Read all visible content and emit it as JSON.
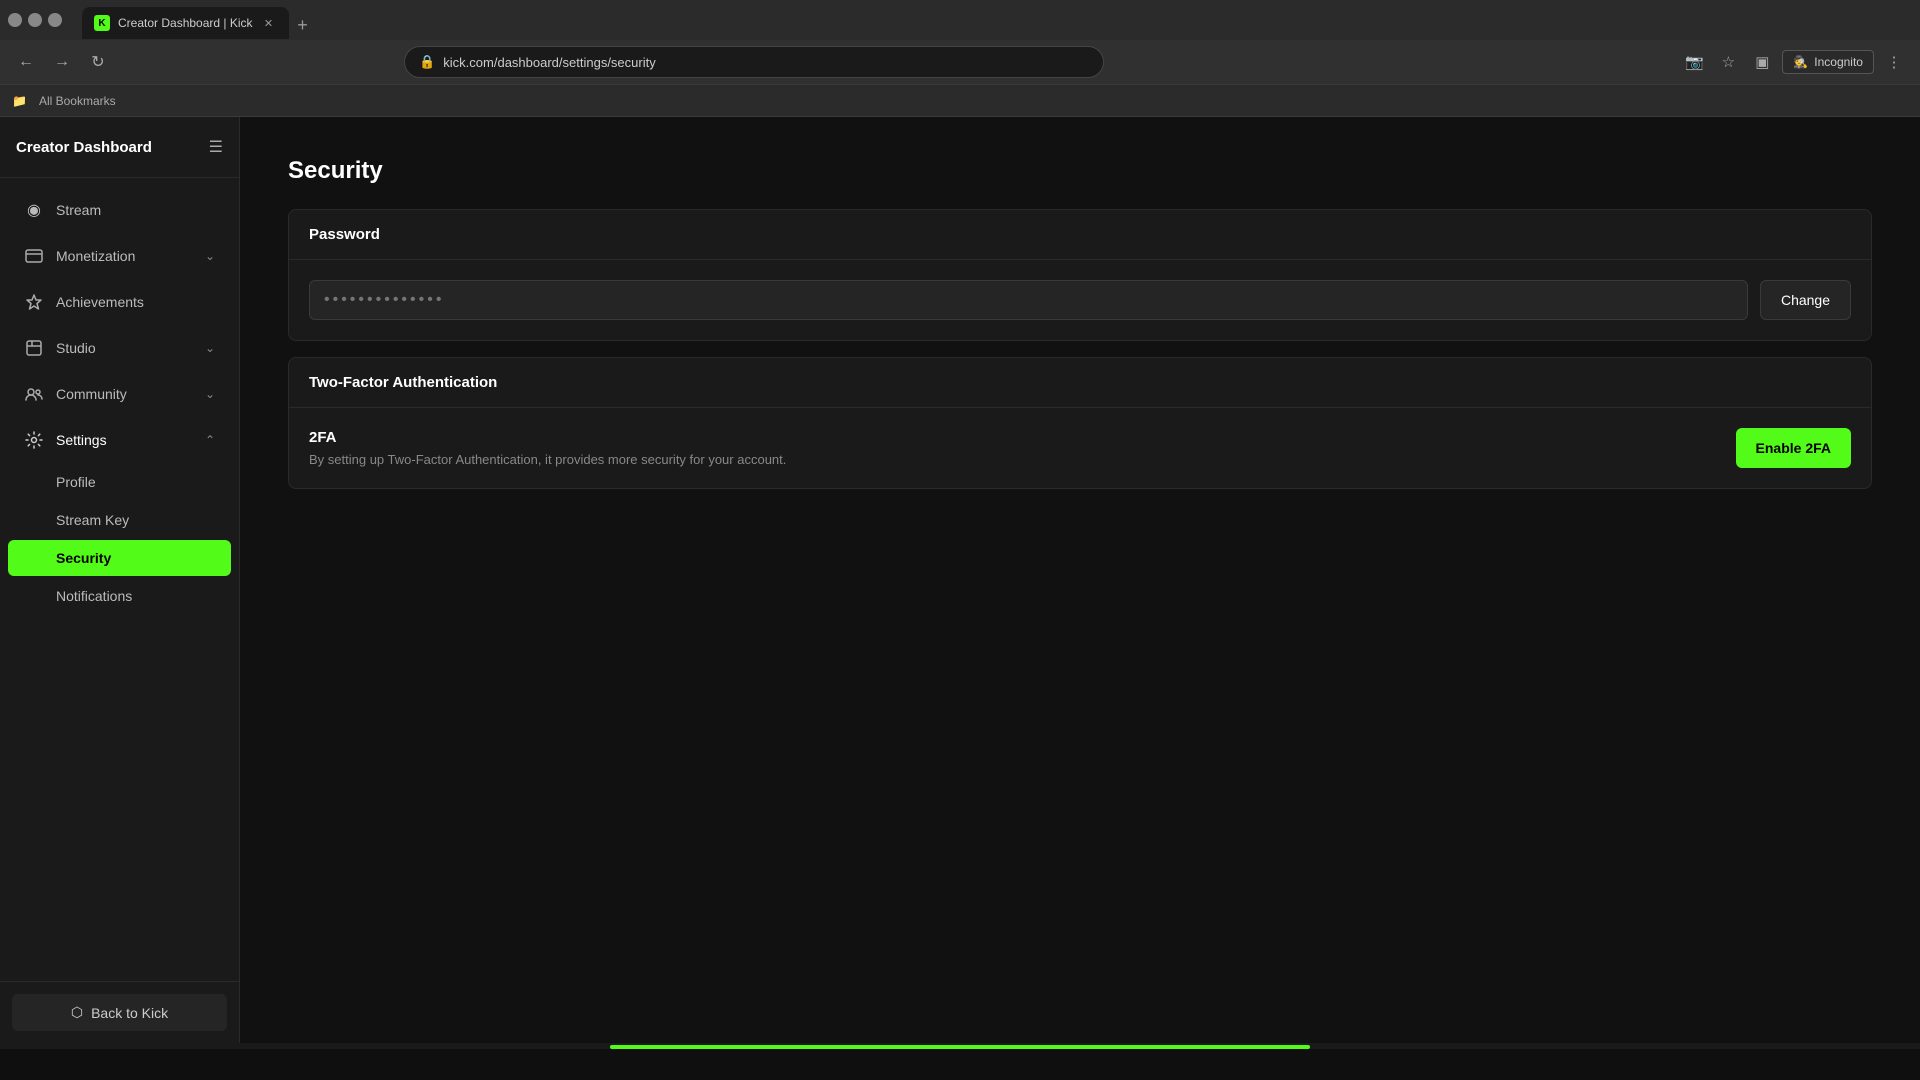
{
  "browser": {
    "tab_title": "Creator Dashboard | Kick",
    "tab_favicon": "K",
    "url": "kick.com/dashboard/settings/security",
    "incognito_label": "Incognito",
    "bookmarks_label": "All Bookmarks"
  },
  "sidebar": {
    "title": "Creator Dashboard",
    "toggle_icon": "☰",
    "nav_items": [
      {
        "id": "stream",
        "label": "Stream",
        "icon": "◉",
        "has_chevron": false
      },
      {
        "id": "monetization",
        "label": "Monetization",
        "icon": "□",
        "has_chevron": true
      },
      {
        "id": "achievements",
        "label": "Achievements",
        "icon": "🏆",
        "has_chevron": false
      },
      {
        "id": "studio",
        "label": "Studio",
        "icon": "□",
        "has_chevron": true
      },
      {
        "id": "community",
        "label": "Community",
        "icon": "◎",
        "has_chevron": true
      },
      {
        "id": "settings",
        "label": "Settings",
        "icon": "⚙",
        "has_chevron": true,
        "expanded": true
      }
    ],
    "settings_sub_items": [
      {
        "id": "profile",
        "label": "Profile",
        "active": false
      },
      {
        "id": "stream-key",
        "label": "Stream Key",
        "active": false
      },
      {
        "id": "security",
        "label": "Security",
        "active": true
      },
      {
        "id": "notifications",
        "label": "Notifications",
        "active": false
      }
    ],
    "back_to_kick": "Back to Kick"
  },
  "main": {
    "page_title": "Security",
    "password_section": {
      "title": "Password",
      "password_placeholder": "••••••••••••••",
      "change_button": "Change"
    },
    "tfa_section": {
      "title": "Two-Factor Authentication",
      "tfa_label": "2FA",
      "tfa_description": "By setting up Two-Factor Authentication, it provides more security for your account.",
      "enable_button": "Enable 2FA"
    }
  },
  "colors": {
    "accent": "#53fc18",
    "bg_sidebar": "#1a1a1a",
    "bg_main": "#111111",
    "active_sub_item_bg": "#53fc18",
    "active_sub_item_text": "#000000"
  }
}
